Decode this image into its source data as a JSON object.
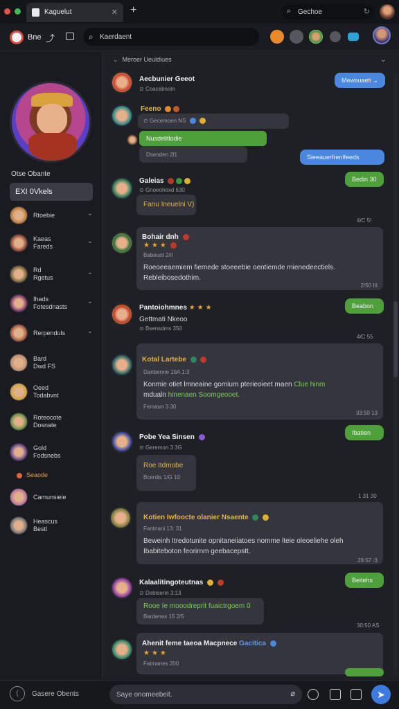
{
  "browser": {
    "tab_title": "Kaguelut",
    "search_text": "Gechoe"
  },
  "app": {
    "name": "Bne",
    "search_text": "Kaerdaent"
  },
  "sidebar": {
    "username": "Otse Obante",
    "active_channel": "EXI 0Vkels",
    "items": [
      {
        "line1": "Rtoebie",
        "line2": "",
        "chevron": true,
        "color": "#b8722f"
      },
      {
        "line1": "Kaeas",
        "line2": "Fareds",
        "chevron": true,
        "color": "#8a3a2a"
      },
      {
        "line1": "Rd",
        "line2": "Rgetus",
        "chevron": true,
        "color": "#6b5b2a"
      },
      {
        "line1": "Ihads",
        "line2": "Fotesdnasts",
        "chevron": true,
        "color": "#7a2a6a"
      },
      {
        "line1": "Rerpenduls",
        "line2": "",
        "chevron": true,
        "color": "#a05030"
      },
      {
        "line1": "Bard",
        "line2": "Dwd FS",
        "chevron": false,
        "color": "#b58a6a"
      },
      {
        "line1": "Oeed",
        "line2": "Todabvnt",
        "chevron": false,
        "color": "#d0a030"
      },
      {
        "line1": "Roteocote",
        "line2": "Dosnate",
        "chevron": false,
        "color": "#5a8a3a"
      },
      {
        "line1": "Gold",
        "line2": "Fodsnebs",
        "chevron": false,
        "color": "#5a3a8a"
      },
      {
        "line1": "Camunsieie",
        "line2": "",
        "chevron": false,
        "color": "#b86aa0"
      },
      {
        "line1": "Heascus",
        "line2": "Bestl",
        "chevron": false,
        "color": "#6a6a70"
      }
    ],
    "small_label": "Seaode"
  },
  "chat": {
    "header": "Meroer Ueuldiues",
    "messages": [
      {
        "name": "Aecbunier Geeot",
        "sub": "Coacebnoin",
        "pill": "Mewsuaeti",
        "pill_color": "blue"
      },
      {
        "name": "Feeno",
        "sub": "Gecemoen NS",
        "bubble1": "Nusdelitlodie",
        "bubble1_sub": "Dsenden 2l1",
        "pill": "Sieeauerfrenlfeeds"
      },
      {
        "name": "Galeias",
        "sub": "Gnoeohoxd 630",
        "inline": "Fanu Ineuelni V)",
        "pill": "Bedin 30",
        "ts": "4/C 5!"
      },
      {
        "name": "Bohair dnh",
        "sub": "Babeuot 2/il",
        "body": "Roeoeeaemiem fiemede stoeeebie oentiemde mienedeectiels. Rebleibosedothim.",
        "ts": "2/50 III"
      },
      {
        "name": "Pantoiohmnes",
        "sub": "Gettmati Nkeoo",
        "sub2": "Bsensdms 350",
        "pill": "Beabon",
        "ts": "4/C 55"
      },
      {
        "name": "Kotal Lartebe",
        "sub": "Danbenne 19A 1:3",
        "body": "Konmie otiet lmneaine gomium pterieoieet maen",
        "body_green": "Clue hinm",
        "body2": "mdualn",
        "body2_green": "hinenaen Soomgeooet.",
        "sub2": "Femaun 3 30",
        "ts": "33:50 13"
      },
      {
        "name": "Pobe Yea Sinsen",
        "sub": "Geremon 3 3G",
        "inline": "Roe Itdmobe",
        "inline_sub": "Bcerdis 1/G 10",
        "pill": "Ibatien",
        "ts": "1 31 30"
      },
      {
        "name": "Kotien Iwfoocte olanier Nsaente",
        "sub": "Fantnani 13: 31",
        "body": "Beweinh Itredotunite opnitaneiiatoes nomme lteie oleoeliehe oleh Ibabiteboton feorirnm geebacepstt.",
        "ts": "29:57 :3"
      },
      {
        "name": "Kalaalitingoteutnas",
        "sub": "Debisenn 3:13",
        "body_green": "Rooe Ie mooodreprit fuaictrgoem 0",
        "sub2": "Bardenes 15 2/5",
        "pill": "Beitehs",
        "ts": "30:50 AS"
      },
      {
        "name": "Ahenit feme taeoa Macpnece",
        "name_blue": "Gacitica",
        "sub": "Fatmanes 200",
        "pill": ""
      }
    ]
  },
  "composer": {
    "placeholder": "Saye onomeebeit."
  },
  "bottom": {
    "status": "Gasere Obents"
  }
}
